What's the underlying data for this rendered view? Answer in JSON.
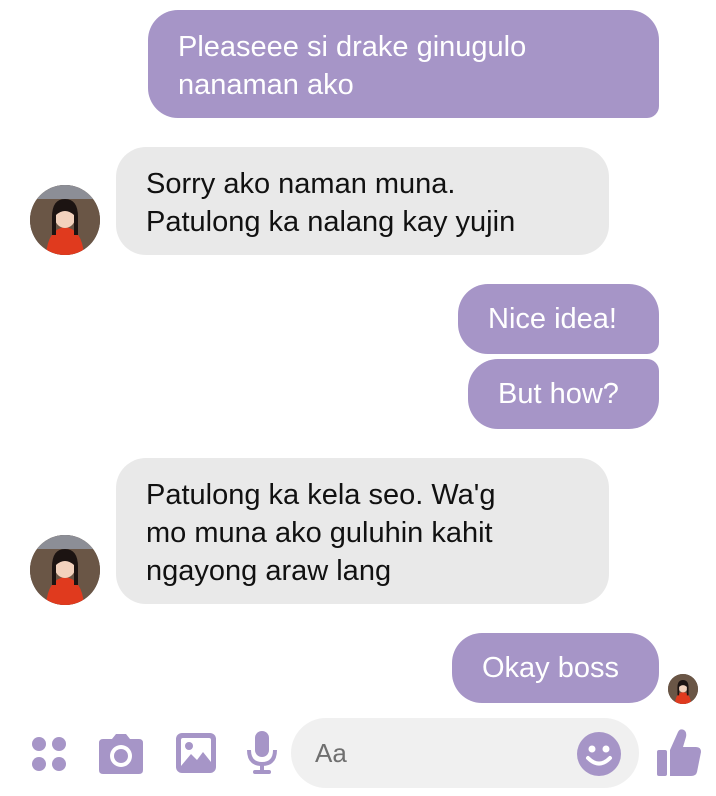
{
  "conversation": {
    "messages": [
      {
        "side": "out",
        "text": "Pleaseee si drake ginugulo\nnanaman ako"
      },
      {
        "side": "in",
        "text": "Sorry ako naman muna.\nPatulong ka nalang kay yujin"
      },
      {
        "side": "out",
        "text": "Nice idea!"
      },
      {
        "side": "out",
        "text": "But how?"
      },
      {
        "side": "in",
        "text": "Patulong ka kela seo. Wa'g\nmo muna ako guluhin kahit\nngayong araw lang"
      },
      {
        "side": "out",
        "text": "Okay boss"
      }
    ]
  },
  "composer": {
    "placeholder": "Aa",
    "icons": [
      "apps-grid-icon",
      "camera-icon",
      "gallery-icon",
      "microphone-icon",
      "emoji-icon",
      "thumbs-up-icon"
    ]
  },
  "colors": {
    "accent": "#a695c7",
    "incoming_bubble": "#e9e9e9",
    "outgoing_text": "#ffffff",
    "incoming_text": "#111111"
  }
}
